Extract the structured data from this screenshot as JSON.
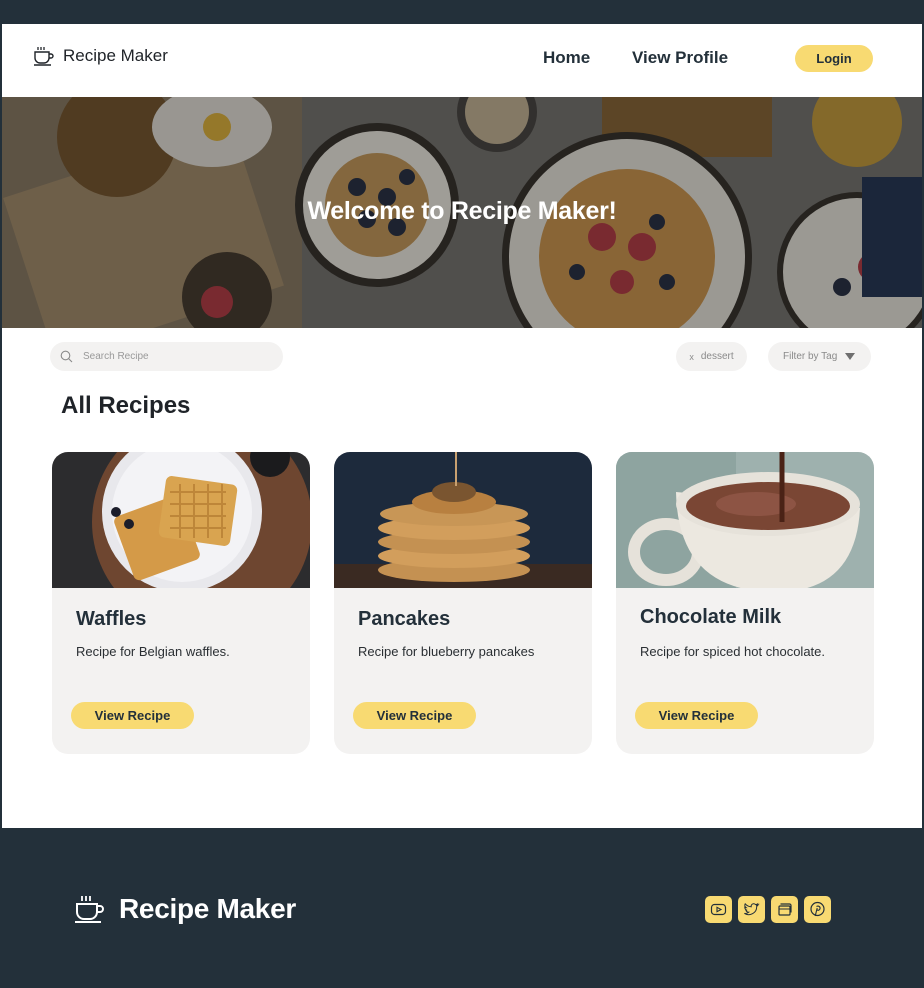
{
  "header": {
    "brand": "Recipe Maker",
    "nav": {
      "home": "Home",
      "profile": "View Profile"
    },
    "login_label": "Login"
  },
  "hero": {
    "title": "Welcome to Recipe Maker!"
  },
  "search": {
    "placeholder": "Search Recipe"
  },
  "filters": {
    "active_tag_remove": "x",
    "active_tag": "dessert",
    "filter_label": "Filter by Tag"
  },
  "section": {
    "title": "All Recipes"
  },
  "recipes": [
    {
      "title": "Waffles",
      "description": "Recipe for Belgian waffles.",
      "button": "View Recipe"
    },
    {
      "title": "Pancakes",
      "description": "Recipe for blueberry pancakes",
      "button": "View Recipe"
    },
    {
      "title": "Chocolate Milk",
      "description": "Recipe for spiced hot chocolate.",
      "button": "View Recipe"
    }
  ],
  "footer": {
    "brand": "Recipe Maker",
    "socials": [
      "youtube-icon",
      "twitter-icon",
      "gallery-icon",
      "pinterest-icon"
    ]
  },
  "colors": {
    "accent": "#f8da72",
    "dark": "#23303a",
    "card_bg": "#f3f2f1"
  }
}
